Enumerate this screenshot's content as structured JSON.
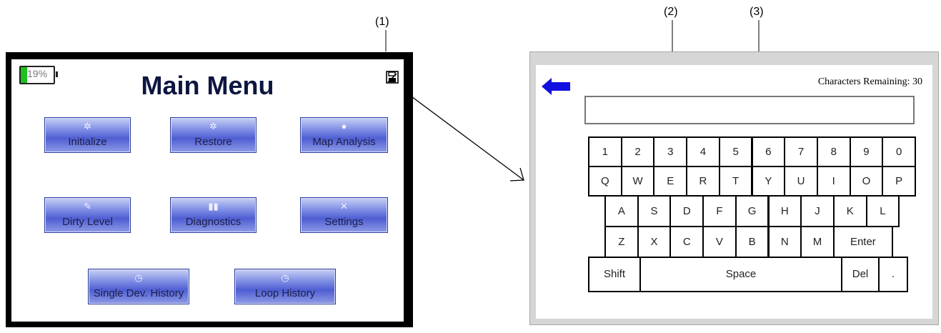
{
  "callouts": {
    "c1": "(1)",
    "c2": "(2)",
    "c3": "(3)"
  },
  "main_menu": {
    "battery": "19%",
    "battery_level": 0.19,
    "title": "Main Menu",
    "save_icon": "save-disk-icon",
    "buttons": [
      {
        "label": "Initialize",
        "icon": "gear-icon"
      },
      {
        "label": "Restore",
        "icon": "restore-icon"
      },
      {
        "label": "Map Analysis",
        "icon": "map-icon"
      },
      {
        "label": "Dirty Level",
        "icon": "broom-icon"
      },
      {
        "label": "Diagnostics",
        "icon": "diagnostics-icon"
      },
      {
        "label": "Settings",
        "icon": "tools-icon"
      },
      {
        "label": "Single Dev. History",
        "icon": "stopwatch-icon"
      },
      {
        "label": "Loop History",
        "icon": "stopwatch-icon"
      }
    ]
  },
  "keyboard_screen": {
    "back_icon": "back-arrow-icon",
    "chars_remaining": "Characters Remaining: 30",
    "input_value": "",
    "row1": [
      "1",
      "2",
      "3",
      "4",
      "5",
      "6",
      "7",
      "8",
      "9",
      "0"
    ],
    "row2": [
      "Q",
      "W",
      "E",
      "R",
      "T",
      "Y",
      "U",
      "I",
      "O",
      "P"
    ],
    "row3": [
      "A",
      "S",
      "D",
      "F",
      "G",
      "H",
      "J",
      "K",
      "L"
    ],
    "row4": [
      "Z",
      "X",
      "C",
      "V",
      "B",
      "N",
      "M",
      "Enter"
    ],
    "row5": [
      "Shift",
      "Space",
      "Del",
      "."
    ]
  },
  "colors": {
    "accent_blue": "#1010e0",
    "battery_green": "#1fbf1f",
    "button_blue": "#4f5ed2"
  }
}
